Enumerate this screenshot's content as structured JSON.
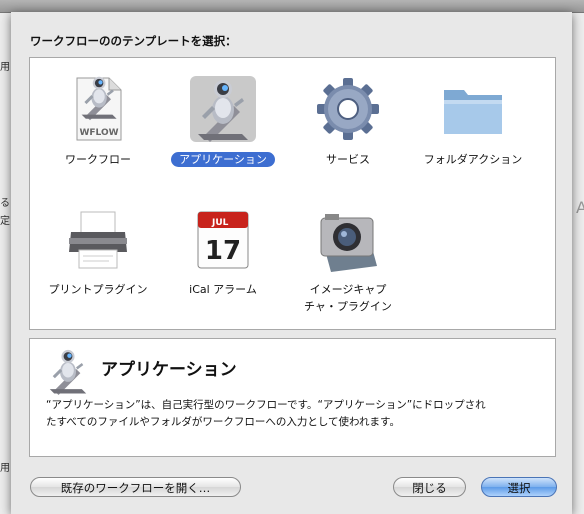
{
  "background_window": {
    "side_text": [
      "用",
      "る",
      "定",
      "用"
    ],
    "right_text": "A"
  },
  "dialog": {
    "prompt": "ワークフローののテンプレートを選択：",
    "templates": [
      {
        "label": "ワークフロー",
        "icon": "workflow-document-icon",
        "badge": "WFLOW",
        "selected": false
      },
      {
        "label": "アプリケーション",
        "icon": "automator-robot-icon",
        "selected": true
      },
      {
        "label": "サービス",
        "icon": "gear-icon",
        "selected": false
      },
      {
        "label": "フォルダアクション",
        "icon": "folder-icon",
        "selected": false
      },
      {
        "label": "プリントプラグイン",
        "icon": "printer-icon",
        "selected": false
      },
      {
        "label": "iCal アラーム",
        "icon": "ical-calendar-icon",
        "cal_month": "JUL",
        "cal_day": "17",
        "selected": false
      },
      {
        "label_line1": "イメージキャプ",
        "label_line2": "チャ・プラグイン",
        "icon": "camera-icon",
        "selected": false
      }
    ],
    "description": {
      "title": "アプリケーション",
      "icon": "automator-robot-icon",
      "line1": "“アプリケーション”は、自己実行型のワークフローです。“アプリケーション”にドロップされ",
      "line2": "たすべてのファイルやフォルダがワークフローへの入力として使われます。"
    },
    "buttons": {
      "open_existing": "既存のワークフローを開く…",
      "close": "閉じる",
      "choose": "選択"
    },
    "colors": {
      "selection": "#3d6ed1",
      "default_button": "#5d9be8"
    }
  }
}
